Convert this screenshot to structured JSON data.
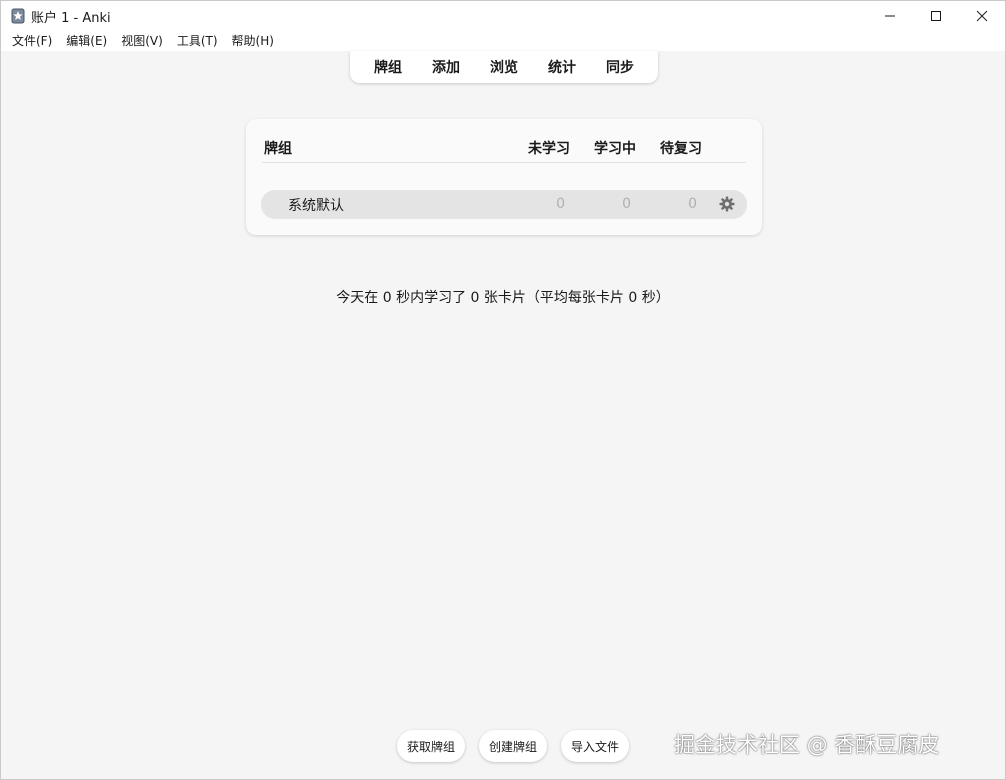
{
  "window": {
    "title": "账户 1 - Anki"
  },
  "menu": {
    "items": [
      {
        "label": "文件(F)"
      },
      {
        "label": "编辑(E)"
      },
      {
        "label": "视图(V)"
      },
      {
        "label": "工具(T)"
      },
      {
        "label": "帮助(H)"
      }
    ]
  },
  "toolbar": {
    "items": [
      {
        "label": "牌组"
      },
      {
        "label": "添加"
      },
      {
        "label": "浏览"
      },
      {
        "label": "统计"
      },
      {
        "label": "同步"
      }
    ]
  },
  "deck_table": {
    "headers": {
      "deck": "牌组",
      "new": "未学习",
      "learn": "学习中",
      "due": "待复习"
    },
    "rows": [
      {
        "name": "系统默认",
        "new": "0",
        "learn": "0",
        "due": "0"
      }
    ]
  },
  "stats": {
    "today": "今天在 0 秒内学习了 0 张卡片（平均每张卡片 0 秒）"
  },
  "bottom": {
    "get_shared": "获取牌组",
    "create_deck": "创建牌组",
    "import_file": "导入文件"
  },
  "watermark": "掘金技术社区 @ 香酥豆腐皮",
  "icons": {
    "app": "anki-app-icon",
    "gear": "gear-icon"
  }
}
